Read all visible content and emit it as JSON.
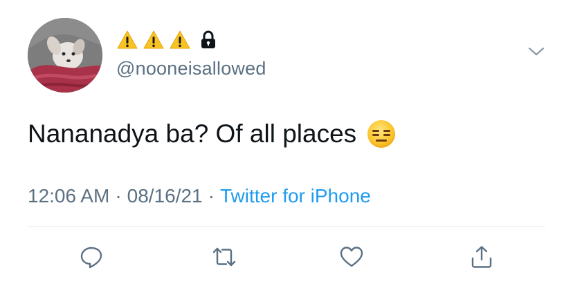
{
  "user": {
    "display_name_icons": [
      "warning-emoji",
      "warning-emoji",
      "warning-emoji",
      "lock-icon"
    ],
    "handle": "@nooneisallowed"
  },
  "tweet": {
    "text": "Nananadya ba? Of all places",
    "trailing_emoji": "expressionless-face-emoji"
  },
  "meta": {
    "time": "12:06 AM",
    "separator": "·",
    "date": "08/16/21",
    "source": "Twitter for iPhone"
  },
  "actions": [
    "reply-icon",
    "retweet-icon",
    "like-icon",
    "share-icon"
  ],
  "colors": {
    "text": "#0f1419",
    "secondary": "#5b7083",
    "link": "#1d9bf0",
    "divider": "#e1e8ed"
  }
}
